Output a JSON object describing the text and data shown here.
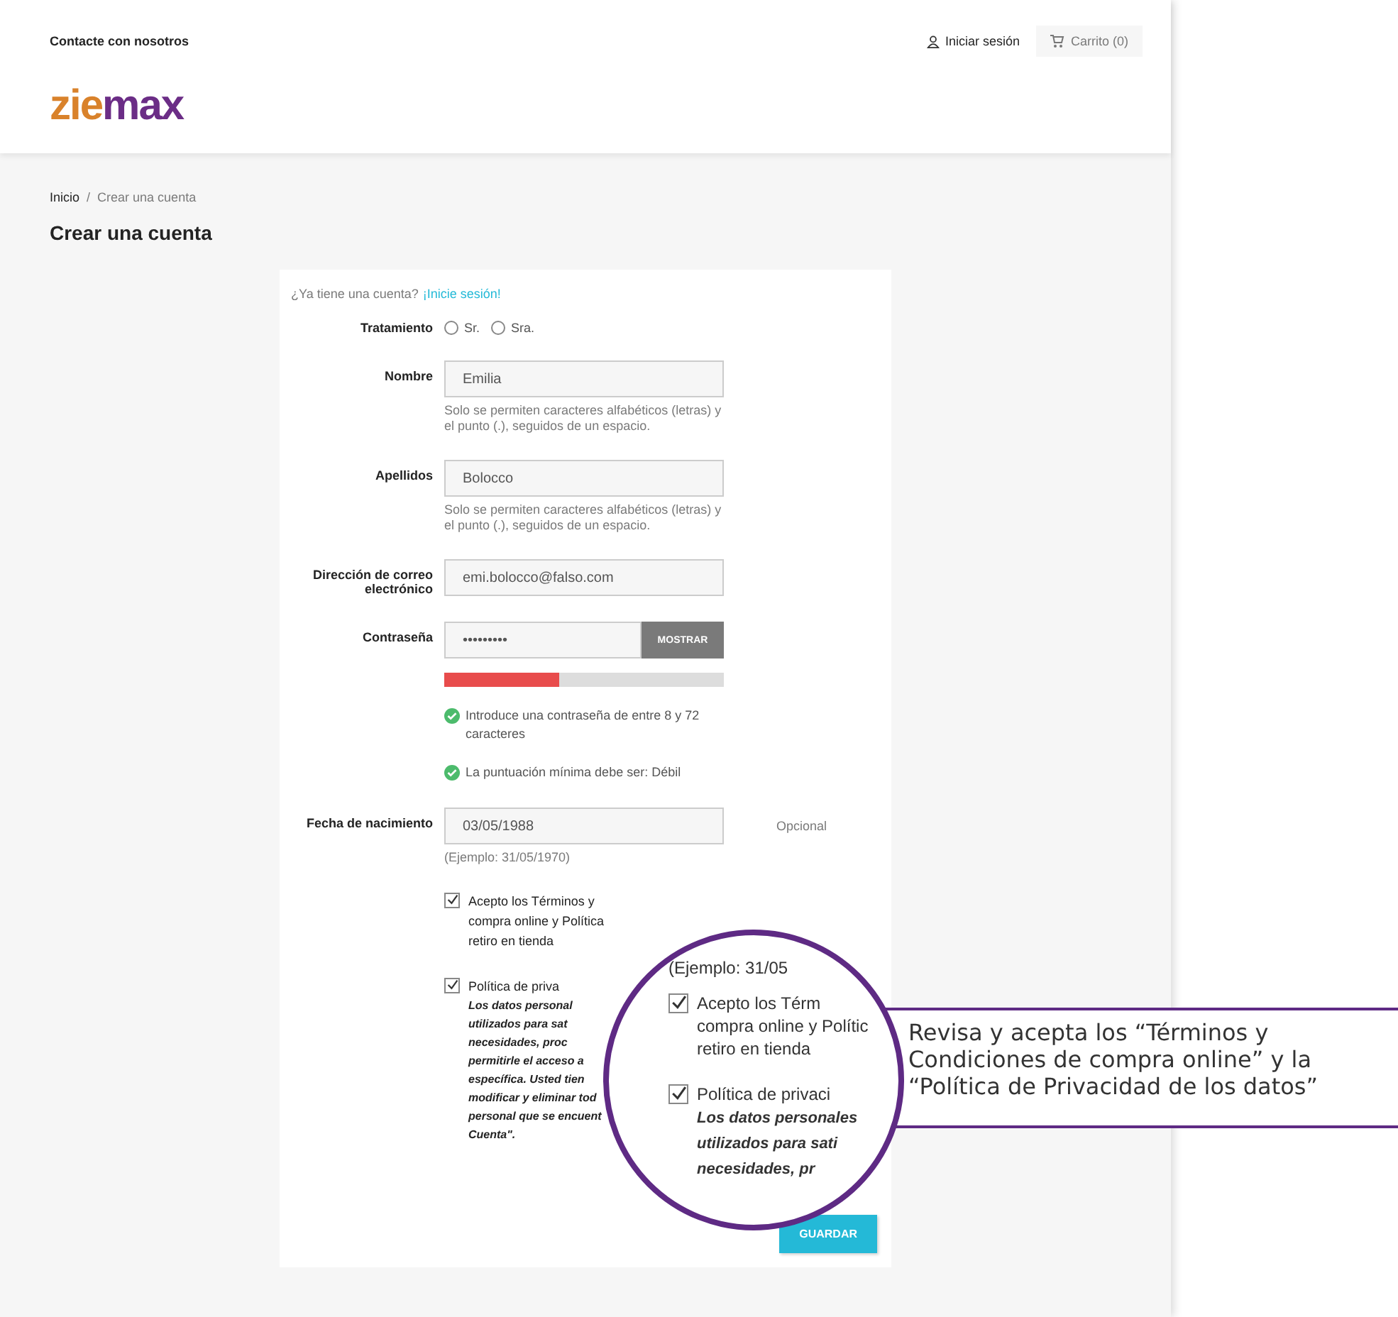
{
  "top_bar": {
    "contact": "Contacte con nosotros",
    "sign_in": "Iniciar sesión",
    "cart": "Carrito (0)"
  },
  "logo_parts": [
    "zie",
    "max"
  ],
  "breadcrumb": [
    "Inicio",
    "/",
    "Crear una cuenta"
  ],
  "page_title": "Crear una cuenta",
  "form": {
    "have_account": "¿Ya tiene una cuenta?",
    "sign_in_link": "¡Inicie sesión!",
    "title_label": "Tratamiento",
    "title_options": [
      {
        "label": "Sr.",
        "selected": false
      },
      {
        "label": "Sra.",
        "selected": false
      }
    ],
    "fields": [
      {
        "kind": "text",
        "label": "Nombre",
        "value": "Emilia",
        "note": "Solo se permiten caracteres alfabéticos (letras) y el punto (.), seguidos de un espacio."
      },
      {
        "kind": "text",
        "label": "Apellidos",
        "value": "Bolocco",
        "note": "Solo se permiten caracteres alfabéticos (letras) y el punto (.), seguidos de un espacio."
      },
      {
        "kind": "text",
        "label": "Dirección de correo electrónico",
        "value": "emi.bolocco@falso.com"
      },
      {
        "kind": "password",
        "label": "Contraseña",
        "value": "•••••••••",
        "button": "MOSTRAR",
        "level": 0.41,
        "hints": [
          {
            "text": "Introduce una contraseña de entre 8 y 72 caracteres",
            "met": true
          },
          {
            "text": "La puntuación mínima debe ser: Débil",
            "met": true
          }
        ]
      },
      {
        "kind": "date",
        "label": "Fecha de nacimiento",
        "value": "03/05/1988",
        "note": "(Ejemplo: 31/05/1970)",
        "optional": "Opcional"
      }
    ],
    "checkboxes": [
      {
        "checked": true,
        "lines": [
          "Acepto los Términos y",
          "compra online y Política",
          "retiro en tienda"
        ]
      },
      {
        "checked": true,
        "lines": [
          "Política de priva"
        ],
        "detail_lines": [
          "Los datos personal",
          "utilizados para sat",
          "necesidades, proc",
          "permitirle el acceso a",
          "específica. Usted tien",
          "modificar y eliminar tod",
          "personal que se encuent",
          "Cuenta\"."
        ]
      }
    ],
    "save": "GUARDAR"
  },
  "magnifier": {
    "example": "(Ejemplo: 31/05",
    "checkboxes": [
      {
        "checked": true,
        "lines": [
          "Acepto los Térm",
          "compra online y Polític",
          "retiro en tienda"
        ]
      },
      {
        "checked": true,
        "lines": [
          "Política de privaci"
        ],
        "detail_lines": [
          "Los datos personales",
          "utilizados para sati",
          "necesidades, pr"
        ]
      }
    ]
  },
  "callout": "Revisa y acepta los “Términos y Condiciones de compra online” y la “Política de Privacidad de los datos”"
}
